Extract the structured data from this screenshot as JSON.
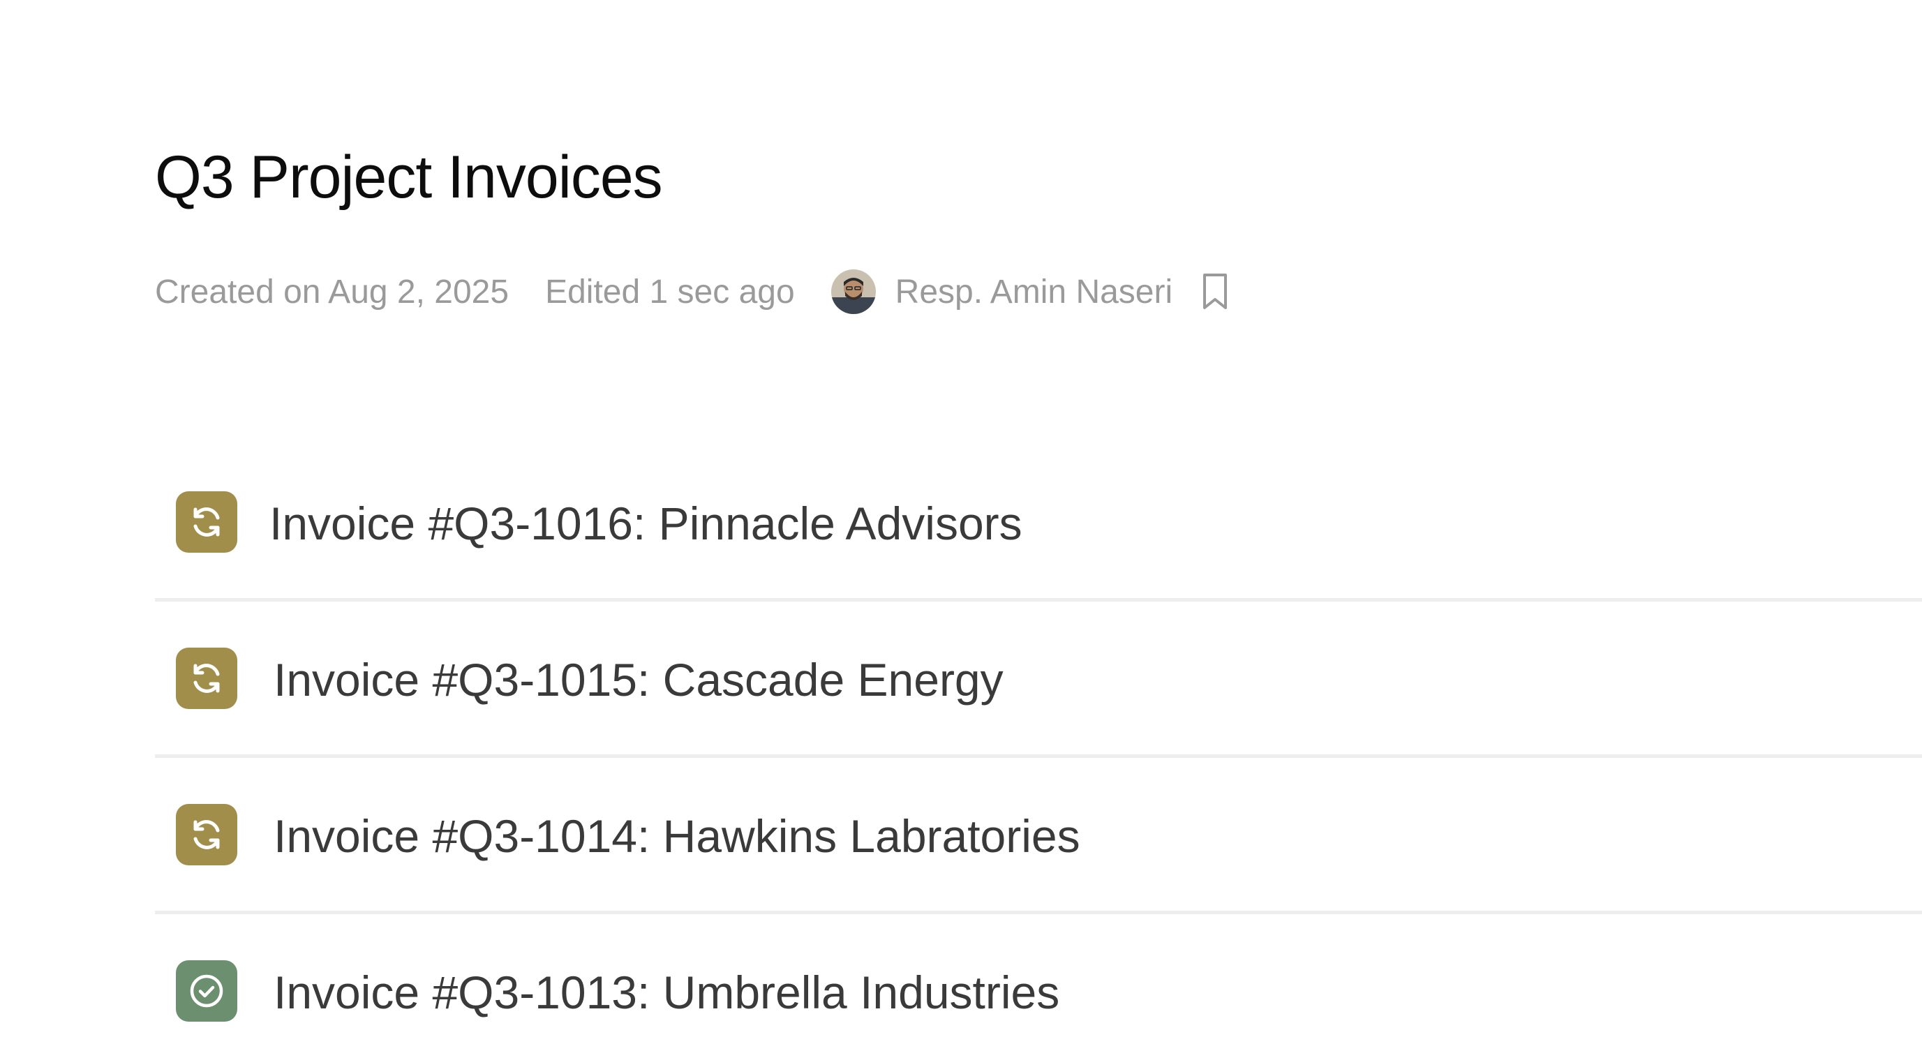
{
  "page": {
    "title": "Q3 Project Invoices"
  },
  "meta": {
    "created": "Created on Aug 2, 2025",
    "edited": "Edited 1 sec ago",
    "responsible": "Resp. Amin Naseri",
    "avatar_icon": "user-avatar",
    "bookmark_icon": "bookmark-icon"
  },
  "colors": {
    "pending_status": "#a08e4a",
    "paid_status": "#6b8f6f",
    "meta_text": "#9a9a9a",
    "divider": "#eeeeee"
  },
  "invoices": [
    {
      "label": "Invoice #Q3-1016: Pinnacle Advisors",
      "status": "pending",
      "icon": "refresh-icon"
    },
    {
      "label": "Invoice #Q3-1015: Cascade Energy",
      "status": "pending",
      "icon": "refresh-icon"
    },
    {
      "label": "Invoice #Q3-1014: Hawkins Labratories",
      "status": "pending",
      "icon": "refresh-icon"
    },
    {
      "label": "Invoice #Q3-1013: Umbrella Industries",
      "status": "paid",
      "icon": "check-circle-icon"
    }
  ]
}
